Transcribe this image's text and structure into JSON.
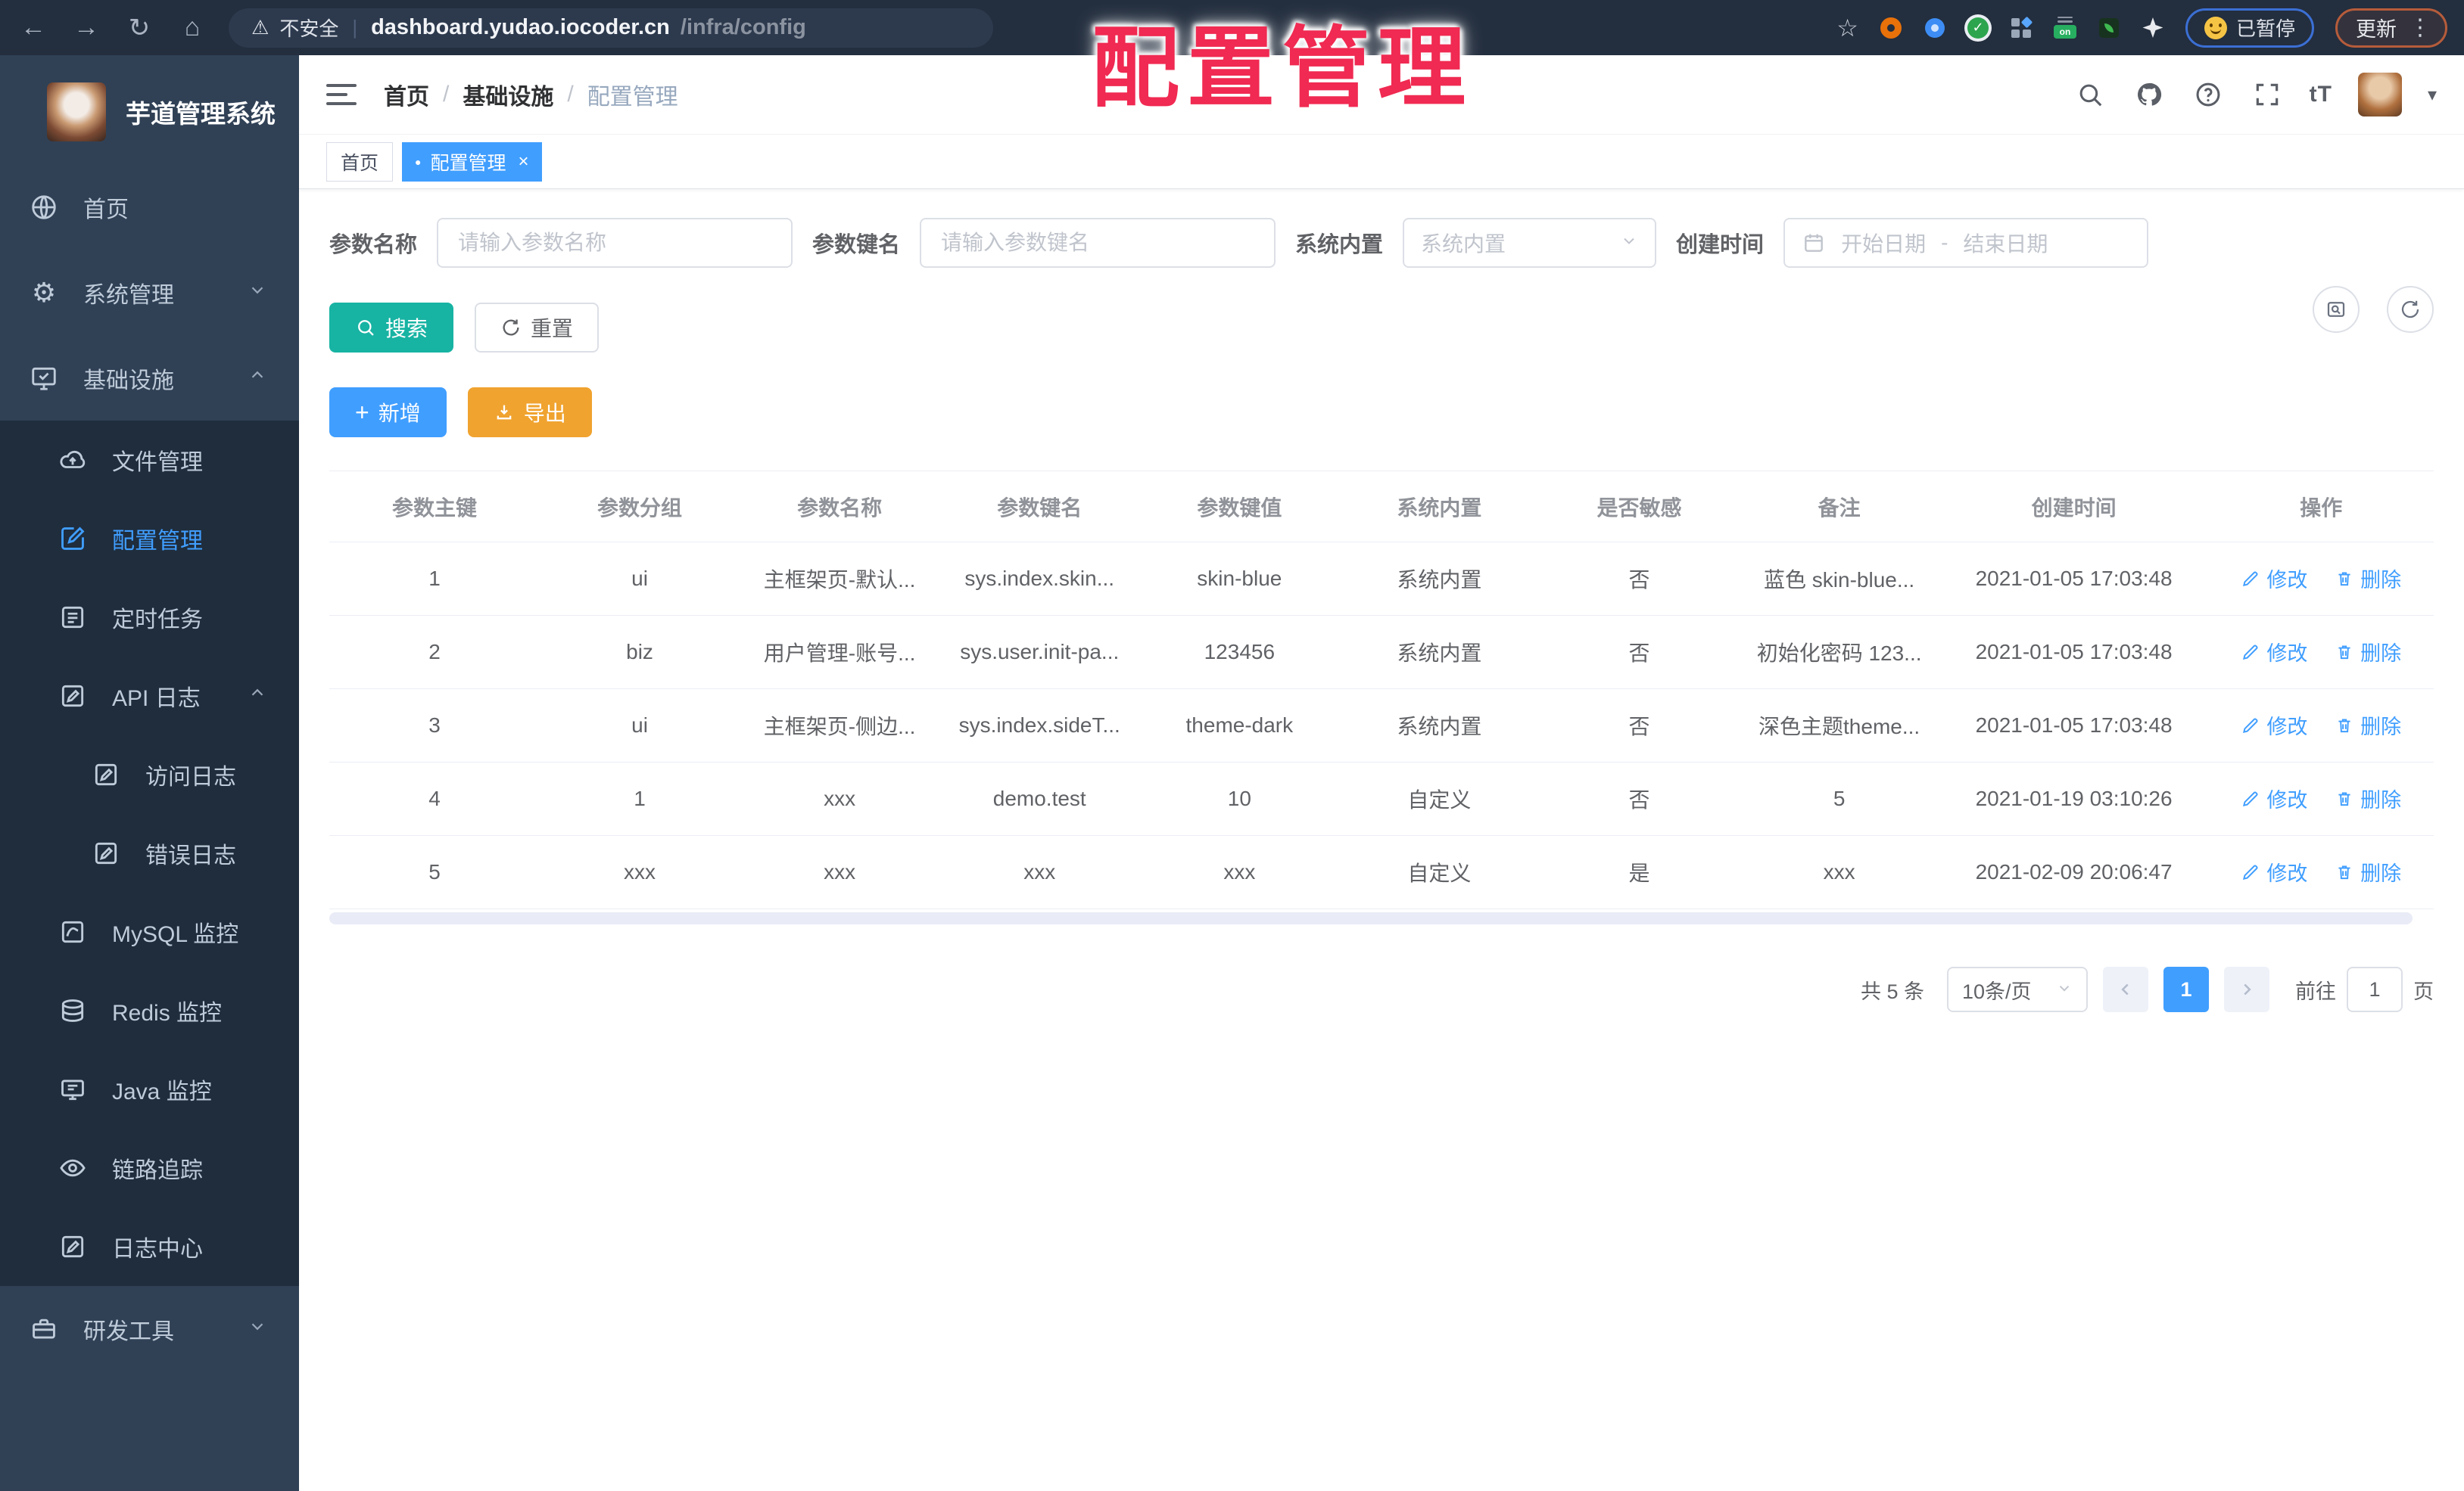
{
  "browser": {
    "security_label": "不安全",
    "url_host": "dashboard.yudao.iocoder.cn",
    "url_path": "/infra/config",
    "ext_on_label": "on",
    "paused_label": "已暂停",
    "update_label": "更新"
  },
  "watermark": "配置管理",
  "glyphs": {
    "back": "←",
    "forward": "→",
    "reload": "↻",
    "home": "⌂",
    "warning": "⚠",
    "pipe": "|",
    "star": "☆",
    "kebab": "⋮",
    "gear": "⚙",
    "close": "×",
    "dot": "●",
    "plus": "+",
    "check": "✓",
    "caret_down": "▾",
    "font_size": "tT",
    "slash": "/"
  },
  "sidebar": {
    "app_title": "芋道管理系统",
    "items": [
      {
        "label": "首页"
      },
      {
        "label": "系统管理"
      },
      {
        "label": "基础设施"
      },
      {
        "label": "文件管理"
      },
      {
        "label": "配置管理"
      },
      {
        "label": "定时任务"
      },
      {
        "label": "API 日志"
      },
      {
        "label": "访问日志"
      },
      {
        "label": "错误日志"
      },
      {
        "label": "MySQL 监控"
      },
      {
        "label": "Redis 监控"
      },
      {
        "label": "Java 监控"
      },
      {
        "label": "链路追踪"
      },
      {
        "label": "日志中心"
      },
      {
        "label": "研发工具"
      }
    ]
  },
  "breadcrumb": {
    "items": [
      "首页",
      "基础设施",
      "配置管理"
    ]
  },
  "tags": {
    "home": "首页",
    "active": "配置管理"
  },
  "filters": {
    "name_label": "参数名称",
    "name_placeholder": "请输入参数名称",
    "key_label": "参数键名",
    "key_placeholder": "请输入参数键名",
    "type_label": "系统内置",
    "type_placeholder": "系统内置",
    "date_label": "创建时间",
    "date_start": "开始日期",
    "date_sep": "-",
    "date_end": "结束日期"
  },
  "toolbar": {
    "search": "搜索",
    "reset": "重置",
    "add": "新增",
    "export": "导出"
  },
  "table": {
    "columns": [
      "参数主键",
      "参数分组",
      "参数名称",
      "参数键名",
      "参数键值",
      "系统内置",
      "是否敏感",
      "备注",
      "创建时间",
      "操作"
    ],
    "edit": "修改",
    "del": "删除",
    "rows": [
      {
        "id": "1",
        "group": "ui",
        "name": "主框架页-默认...",
        "key": "sys.index.skin...",
        "value": "skin-blue",
        "type": "系统内置",
        "sensitive": "否",
        "remark": "蓝色 skin-blue...",
        "created": "2021-01-05 17:03:48"
      },
      {
        "id": "2",
        "group": "biz",
        "name": "用户管理-账号...",
        "key": "sys.user.init-pa...",
        "value": "123456",
        "type": "系统内置",
        "sensitive": "否",
        "remark": "初始化密码 123...",
        "created": "2021-01-05 17:03:48"
      },
      {
        "id": "3",
        "group": "ui",
        "name": "主框架页-侧边...",
        "key": "sys.index.sideT...",
        "value": "theme-dark",
        "type": "系统内置",
        "sensitive": "否",
        "remark": "深色主题theme...",
        "created": "2021-01-05 17:03:48"
      },
      {
        "id": "4",
        "group": "1",
        "name": "xxx",
        "key": "demo.test",
        "value": "10",
        "type": "自定义",
        "sensitive": "否",
        "remark": "5",
        "created": "2021-01-19 03:10:26"
      },
      {
        "id": "5",
        "group": "xxx",
        "name": "xxx",
        "key": "xxx",
        "value": "xxx",
        "type": "自定义",
        "sensitive": "是",
        "remark": "xxx",
        "created": "2021-02-09 20:06:47"
      }
    ]
  },
  "pagination": {
    "total": "共 5 条",
    "size": "10条/页",
    "page": "1",
    "goto": "前往",
    "goto_value": "1",
    "unit": "页"
  }
}
